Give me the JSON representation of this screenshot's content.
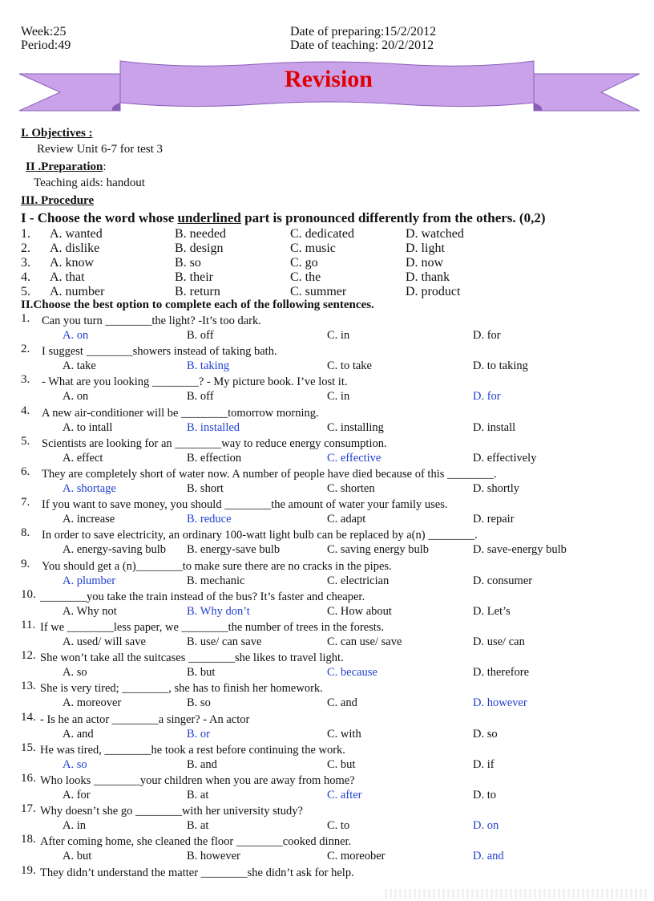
{
  "header": {
    "week": "Week:25",
    "period": "Period:49",
    "date_preparing": "Date of preparing:15/2/2012",
    "date_teaching": "Date of teaching: 20/2/2012"
  },
  "title": "Revision",
  "colors": {
    "banner_fill": "#c9a2ea",
    "banner_stroke": "#8a5fb8",
    "title_red": "#e00000",
    "answer_blue": "#1f3fd0"
  },
  "objectives": {
    "heading": "I. Objectives :",
    "text": "Review Unit  6-7  for test 3"
  },
  "preparation": {
    "heading": "II .Preparation",
    "colon": ":",
    "text": "Teaching aids: handout"
  },
  "procedure": {
    "heading": "III. Procedure"
  },
  "part1": {
    "heading_pre": "I -  Choose the word whose ",
    "heading_ul": "underlined",
    "heading_post": " part is pronounced differently from the others. (0,2)",
    "rows": [
      {
        "num": "1.",
        "a": "A. wanted",
        "b": "B. needed",
        "c": "C. dedicated",
        "d": "D. watched"
      },
      {
        "num": "2.",
        "a": "A. dislike",
        "b": "B. design",
        "c": "C. music",
        "d": "D. light"
      },
      {
        "num": "3.",
        "a": "A. know",
        "b": "B. so",
        "c": "C. go",
        "d": "D. now"
      },
      {
        "num": "4.",
        "a": "A. that",
        "b": "B. their",
        "c": "C. the",
        "d": "D. thank"
      },
      {
        "num": "5.",
        "a": "A. number",
        "b": "B. return",
        "c": "C. summer",
        "d": "D. product"
      }
    ]
  },
  "part2": {
    "heading": "II.Choose the best option to complete each of the following sentences.",
    "questions": [
      {
        "num": "1.",
        "stem": "Can you turn ________the light? -It’s too dark.",
        "a": "A. on",
        "b": "B. off",
        "c": "C. in",
        "d": "D. for",
        "ans": "a"
      },
      {
        "num": "2.",
        "stem": "I suggest ________showers instead of taking bath.",
        "a": "A. take",
        "b": "B. taking",
        "c": "C. to take",
        "d": "D. to taking",
        "ans": "b"
      },
      {
        "num": "3.",
        "stem": "- What are you looking ________? - My picture book. I’ve lost it.",
        "a": "A. on",
        "b": "B. off",
        "c": "C. in",
        "d": "D. for",
        "ans": "d"
      },
      {
        "num": "4.",
        "stem": "A new air-conditioner will be ________tomorrow morning.",
        "a": "A. to intall",
        "b": "B. installed",
        "c": "C. installing",
        "d": "D. install",
        "ans": "b"
      },
      {
        "num": "5.",
        "stem": "Scientists are looking for an ________way to reduce energy consumption.",
        "a": "A. effect",
        "b": "B. effection",
        "c": "C. effective",
        "d": "D. effectively",
        "ans": "c"
      },
      {
        "num": "6.",
        "stem": "They are completely short of water now. A number of people have died because of this ________.",
        "a": "A. shortage",
        "b": "B. short",
        "c": "C. shorten",
        "d": "D. shortly",
        "ans": "a"
      },
      {
        "num": "7.",
        "stem": "If you want to save money, you should ________the amount of water your family uses.",
        "a": "A. increase",
        "b": "B. reduce",
        "c": "C. adapt",
        "d": "D. repair",
        "ans": "b"
      },
      {
        "num": "8.",
        "stem": "In order to save electricity, an ordinary 100-watt light bulb can be replaced by a(n) ________.",
        "a": "A. energy-saving bulb",
        "b": "B. energy-save bulb",
        "c": "C. saving energy bulb",
        "d": "D. save-energy bulb",
        "ans": ""
      },
      {
        "num": "9.",
        "stem": "You should get a (n)________to make sure there are no cracks in the pipes.",
        "a": "A. plumber",
        "b": "B. mechanic",
        "c": "C. electrician",
        "d": "D. consumer",
        "ans": "a"
      },
      {
        "num": "10.",
        "stem": "________you take the train instead of the bus? It’s faster and cheaper.",
        "a": "A. Why not",
        "b": "B. Why don’t",
        "c": "C. How about",
        "d": "D. Let’s",
        "ans": "b"
      },
      {
        "num": "11.",
        "stem": "If we ________less paper, we ________the number of trees in the forests.",
        "a": "A. used/ will save",
        "b": "B. use/ can save",
        "c": "C. can use/ save",
        "d": "D. use/ can",
        "ans": ""
      },
      {
        "num": "12.",
        "stem": "She won’t take all the suitcases ________she likes to travel light.",
        "a": "A. so",
        "b": "B. but",
        "c": "C. because",
        "d": "D. therefore",
        "ans": "c"
      },
      {
        "num": "13.",
        "stem": "She is very tired; ________, she has to finish her homework.",
        "a": "A. moreover",
        "b": "B. so",
        "c": "C. and",
        "d": "D. however",
        "ans": "d"
      },
      {
        "num": "14.",
        "stem": "- Is he an actor ________a singer? - An actor",
        "a": "A. and",
        "b": "B. or",
        "c": "C. with",
        "d": "D. so",
        "ans": "b"
      },
      {
        "num": "15.",
        "stem": "He was tired, ________he took a rest before continuing the work.",
        "a": "A. so",
        "b": "B. and",
        "c": "C. but",
        "d": "D. if",
        "ans": "a"
      },
      {
        "num": "16.",
        "stem": "Who looks ________your children when you are away from home?",
        "a": "A. for",
        "b": "B. at",
        "c": "C. after",
        "d": "D. to",
        "ans": "c"
      },
      {
        "num": "17.",
        "stem": "Why doesn’t she go ________with her university study?",
        "a": "A. in",
        "b": "B. at",
        "c": "C. to",
        "d": "D. on",
        "ans": "d"
      },
      {
        "num": "18.",
        "stem": "After coming home, she cleaned the floor ________cooked dinner.",
        "a": "A. but",
        "b": "B. however",
        "c": "C. moreober",
        "d": "D. and",
        "ans": "d"
      },
      {
        "num": "19.",
        "stem": "They didn’t understand the matter ________she didn’t ask for help.",
        "a": "",
        "b": "",
        "c": "",
        "d": "",
        "ans": ""
      }
    ]
  }
}
